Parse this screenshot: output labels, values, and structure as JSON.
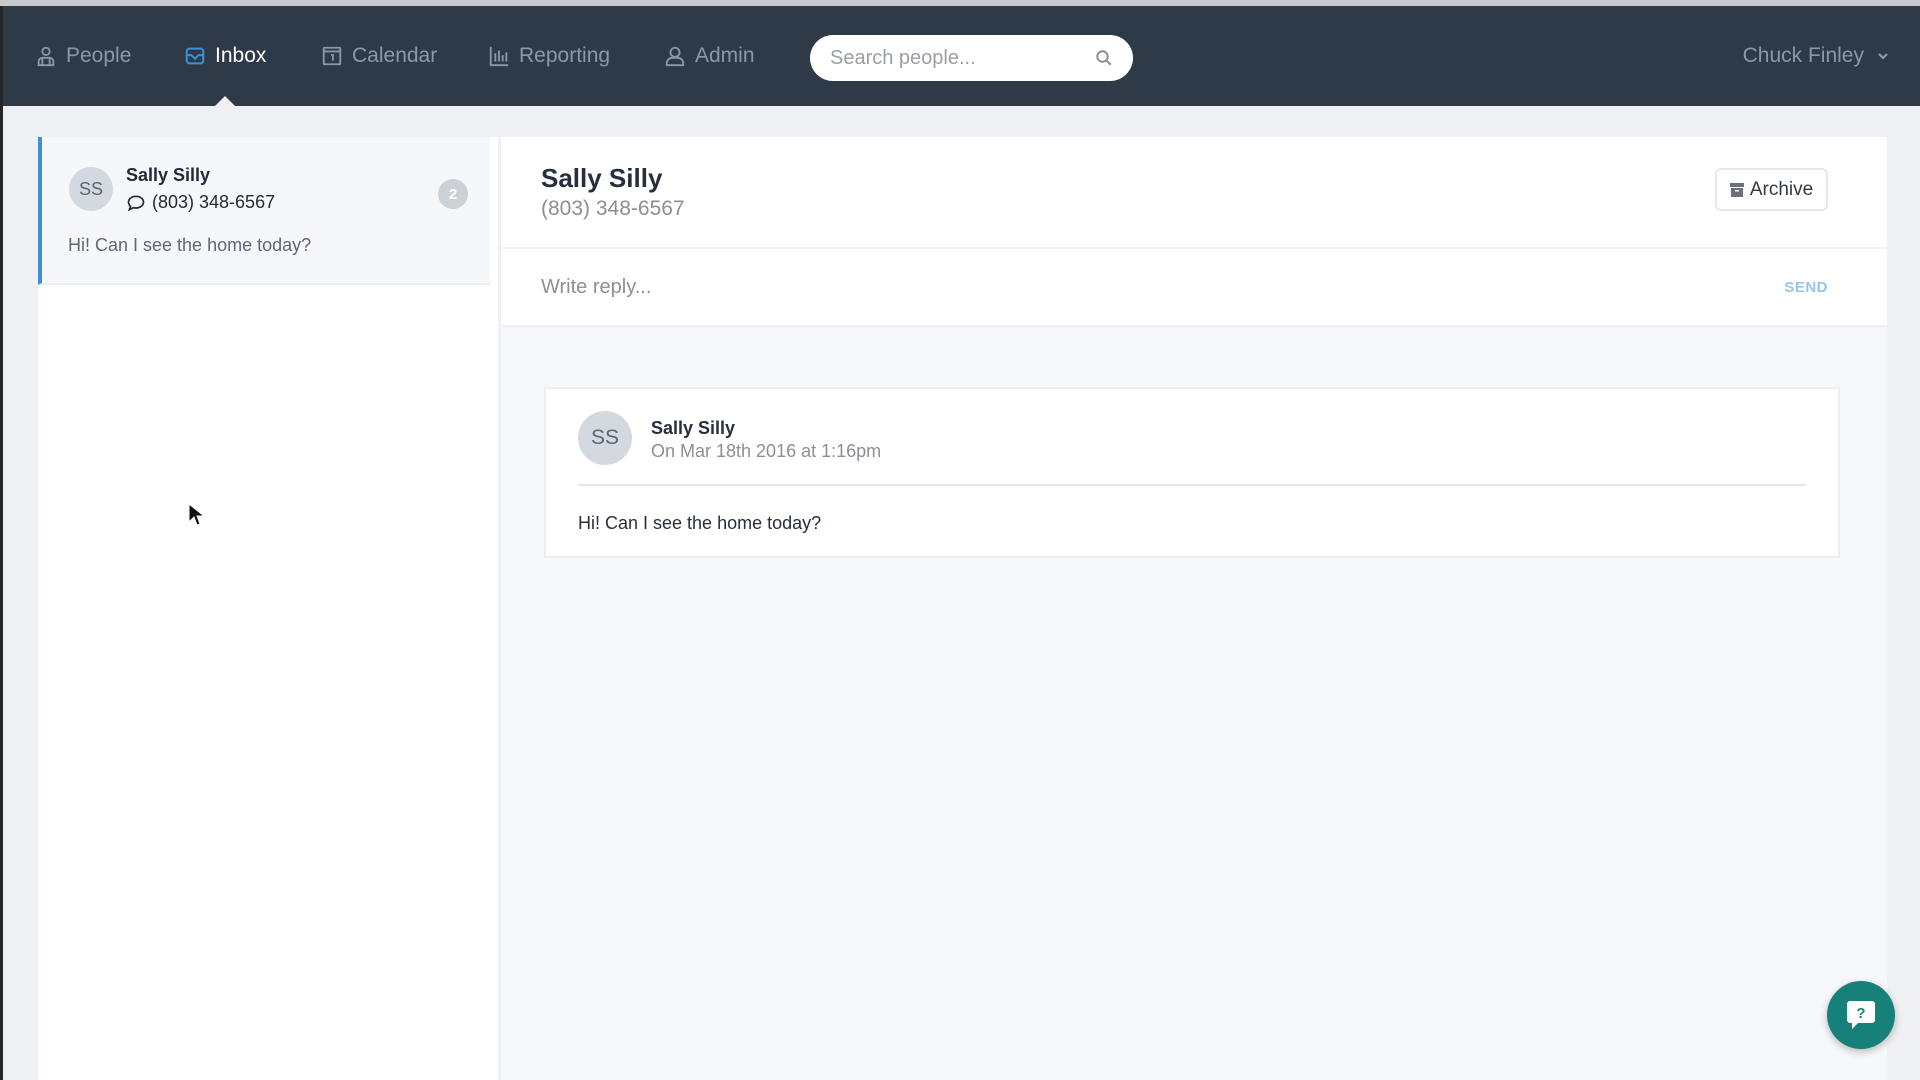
{
  "nav": {
    "items": [
      {
        "label": "People",
        "icon": "people-icon",
        "active": false
      },
      {
        "label": "Inbox",
        "icon": "inbox-icon",
        "active": true
      },
      {
        "label": "Calendar",
        "icon": "calendar-icon",
        "active": false
      },
      {
        "label": "Reporting",
        "icon": "bar-chart-icon",
        "active": false
      },
      {
        "label": "Admin",
        "icon": "user-icon",
        "active": false
      }
    ],
    "search": {
      "placeholder": "Search people...",
      "value": ""
    },
    "user": {
      "name": "Chuck Finley"
    }
  },
  "conversations": [
    {
      "initials": "SS",
      "name": "Sally Silly",
      "phone": "(803) 348-6567",
      "preview": "Hi! Can I see the home today?",
      "unread_count": "2",
      "selected": true
    }
  ],
  "thread": {
    "name": "Sally Silly",
    "phone": "(803) 348-6567",
    "archive_label": "Archive",
    "reply": {
      "placeholder": "Write reply...",
      "value": ""
    },
    "send_label": "SEND",
    "messages": [
      {
        "initials": "SS",
        "sender": "Sally Silly",
        "timestamp": "On Mar 18th 2016 at 1:16pm",
        "body": "Hi! Can I see the home today?"
      }
    ]
  },
  "colors": {
    "navbar": "#2f3a48",
    "accent": "#3d91d6",
    "send": "#93c6ec",
    "help_fab": "#178079"
  },
  "help": {
    "icon": "help-chat-icon"
  }
}
